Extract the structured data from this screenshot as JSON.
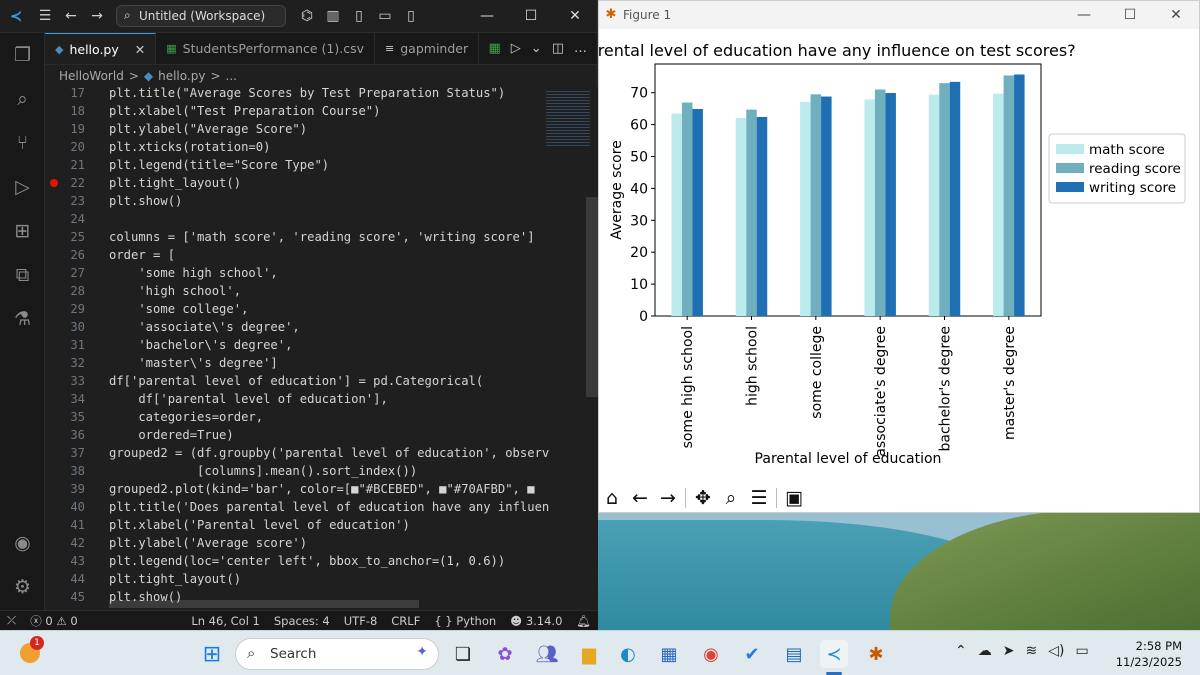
{
  "vscode": {
    "title_search": "Untitled (Workspace)",
    "tabs": [
      {
        "label": "hello.py",
        "icon": "python-icon",
        "active": true
      },
      {
        "label": "StudentsPerformance (1).csv",
        "icon": "csv-icon",
        "active": false
      },
      {
        "label": "gapminder",
        "icon": "notebook-icon",
        "active": false
      }
    ],
    "breadcrumb": [
      "HelloWorld",
      ">",
      "hello.py",
      ">",
      "..."
    ],
    "code": [
      {
        "n": "17",
        "t": "plt.title(\"Average Scores by Test Preparation Status\")"
      },
      {
        "n": "18",
        "t": "plt.xlabel(\"Test Preparation Course\")"
      },
      {
        "n": "19",
        "t": "plt.ylabel(\"Average Score\")"
      },
      {
        "n": "20",
        "t": "plt.xticks(rotation=0)"
      },
      {
        "n": "21",
        "t": "plt.legend(title=\"Score Type\")"
      },
      {
        "n": "22",
        "t": "plt.tight_layout()",
        "breakpoint": true
      },
      {
        "n": "23",
        "t": "plt.show()"
      },
      {
        "n": "24",
        "t": ""
      },
      {
        "n": "25",
        "t": "columns = ['math score', 'reading score', 'writing score']"
      },
      {
        "n": "26",
        "t": "order = ["
      },
      {
        "n": "27",
        "t": "    'some high school',"
      },
      {
        "n": "28",
        "t": "    'high school',"
      },
      {
        "n": "29",
        "t": "    'some college',"
      },
      {
        "n": "30",
        "t": "    'associate\\'s degree',"
      },
      {
        "n": "31",
        "t": "    'bachelor\\'s degree',"
      },
      {
        "n": "32",
        "t": "    'master\\'s degree']"
      },
      {
        "n": "33",
        "t": "df['parental level of education'] = pd.Categorical("
      },
      {
        "n": "34",
        "t": "    df['parental level of education'],"
      },
      {
        "n": "35",
        "t": "    categories=order,"
      },
      {
        "n": "36",
        "t": "    ordered=True)"
      },
      {
        "n": "37",
        "t": "grouped2 = (df.groupby('parental level of education', observ"
      },
      {
        "n": "38",
        "t": "            [columns].mean().sort_index())"
      },
      {
        "n": "39",
        "t": "grouped2.plot(kind='bar', color=[■\"#BCEBED\", ■\"#70AFBD\", ■"
      },
      {
        "n": "40",
        "t": "plt.title('Does parental level of education have any influen"
      },
      {
        "n": "41",
        "t": "plt.xlabel('Parental level of education')"
      },
      {
        "n": "42",
        "t": "plt.ylabel('Average score')"
      },
      {
        "n": "43",
        "t": "plt.legend(loc='center left', bbox_to_anchor=(1, 0.6))"
      },
      {
        "n": "44",
        "t": "plt.tight_layout()"
      },
      {
        "n": "45",
        "t": "plt.show()"
      }
    ],
    "status": {
      "errors": "0",
      "warnings": "0",
      "position": "Ln 46, Col 1",
      "spaces": "Spaces: 4",
      "encoding": "UTF-8",
      "eol": "CRLF",
      "language": "Python",
      "lang_icon": "{ }",
      "version": "3.14.0"
    }
  },
  "figure": {
    "window_title": "Figure 1",
    "toolbar_icons": [
      "home-icon",
      "back-icon",
      "forward-icon",
      "pan-icon",
      "zoom-icon",
      "configure-icon",
      "save-icon"
    ]
  },
  "chart_data": {
    "type": "bar",
    "title": "Does parental level of education have any influence on test scores?",
    "xlabel": "Parental level of education",
    "ylabel": "Average score",
    "categories": [
      "some high school",
      "high school",
      "some college",
      "associate's degree",
      "bachelor's degree",
      "master's degree"
    ],
    "series": [
      {
        "name": "math score",
        "color": "#BCEBED",
        "values": [
          63.5,
          62.1,
          67.1,
          67.9,
          69.4,
          69.7
        ]
      },
      {
        "name": "reading score",
        "color": "#70AFBD",
        "values": [
          66.9,
          64.7,
          69.5,
          71.0,
          73.0,
          75.4
        ]
      },
      {
        "name": "writing score",
        "color": "#1F6FB4",
        "values": [
          64.9,
          62.4,
          68.8,
          69.9,
          73.4,
          75.7
        ]
      }
    ],
    "ylim": [
      0,
      79
    ],
    "yticks": [
      0,
      10,
      20,
      30,
      40,
      50,
      60,
      70
    ],
    "legend_position": "center-right-outside",
    "grid": false
  },
  "taskbar": {
    "search_placeholder": "Search",
    "notification_count": "1",
    "time": "2:58 PM",
    "date": "11/23/2025"
  }
}
